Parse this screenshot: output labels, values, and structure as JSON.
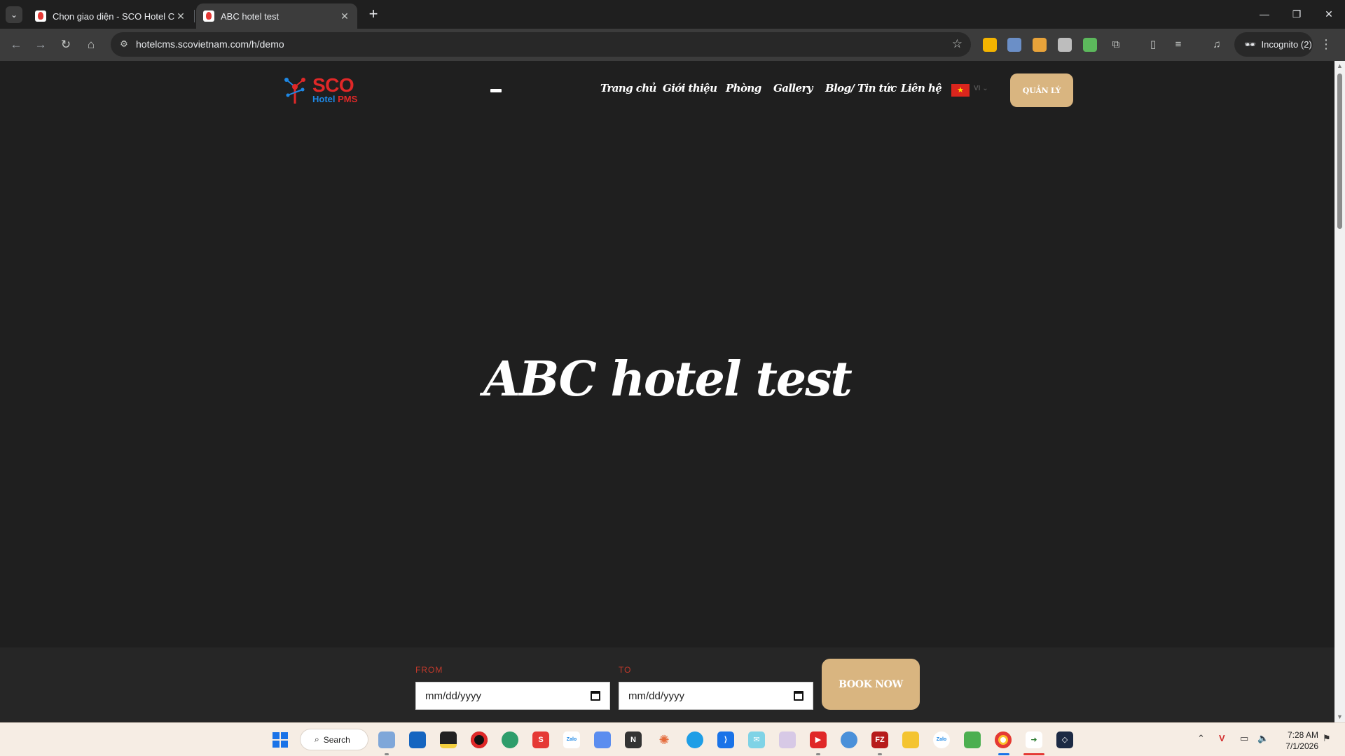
{
  "browser": {
    "tabs": [
      {
        "title": "Chọn giao diện - SCO Hotel CMS",
        "active": false
      },
      {
        "title": "ABC hotel test",
        "active": true
      }
    ],
    "url": "hotelcms.scovietnam.com/h/demo",
    "incognito_label": "Incognito (2)"
  },
  "site": {
    "logo_main": "SCO",
    "logo_sub_a": "Hotel",
    "logo_sub_b": "PMS",
    "nav": [
      "Trang chủ",
      "Giới thiệu",
      "Phòng",
      "Gallery",
      "Blog/ Tin tức",
      "Liên hệ"
    ],
    "language": "VI",
    "manage_label": "QUẢN LÝ",
    "hero_title": "ABC hotel test",
    "booking": {
      "from_label": "FROM",
      "to_label": "TO",
      "from_value": "mm/dd/yyyy",
      "to_value": "mm/dd/yyyy",
      "book_label": "BOOK NOW"
    }
  },
  "taskbar": {
    "search_label": "Search",
    "time": "7:28 AM",
    "date": "7/1/2026"
  },
  "colors": {
    "accent_gold": "#d9b580",
    "page_bg": "#1f1f1f",
    "brand_red": "#e02828",
    "brand_blue": "#1e88e5"
  }
}
